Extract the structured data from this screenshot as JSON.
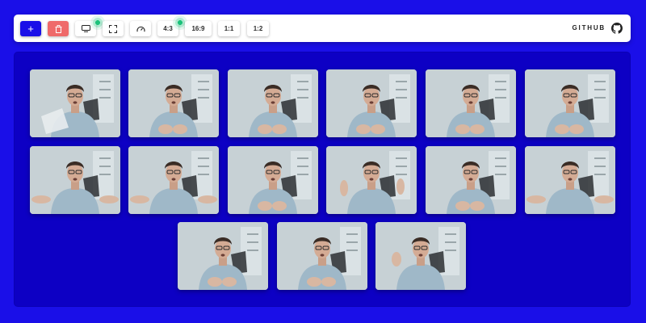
{
  "toolbar": {
    "add_icon": "plus-icon",
    "delete_icon": "trash-icon",
    "screen_icon": "monitor-icon",
    "fullscreen_icon": "fullscreen-icon",
    "speed_icon": "speedometer-icon",
    "ratio_buttons": [
      "4:3",
      "16:9",
      "1:1",
      "1:2"
    ],
    "github_label": "GITHUB",
    "github_icon": "github-icon"
  },
  "grid": {
    "tile_count": 15,
    "rows": [
      6,
      6,
      3
    ]
  },
  "colors": {
    "background": "#1a0fe8",
    "stage": "#0d00c4",
    "accent": "#1a0fe8",
    "delete": "#ef6a6a",
    "indicator": "#1bc27a"
  }
}
